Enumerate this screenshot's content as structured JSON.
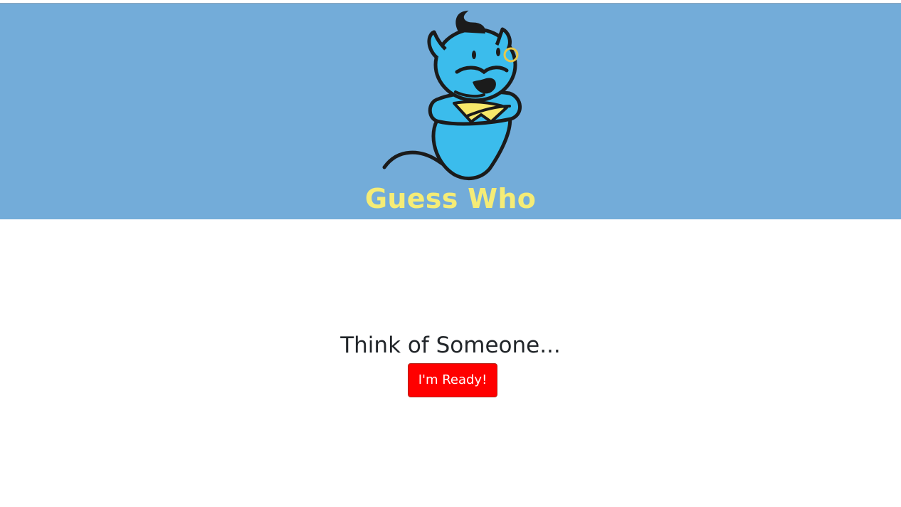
{
  "header": {
    "title": "Guess Who",
    "logo_icon": "genie-mascot-icon",
    "background_color": "#73acd9",
    "title_color": "#f5ec76"
  },
  "main": {
    "prompt": "Think of Someone...",
    "ready_button_label": "I'm Ready!",
    "button_color": "#ff0000"
  }
}
